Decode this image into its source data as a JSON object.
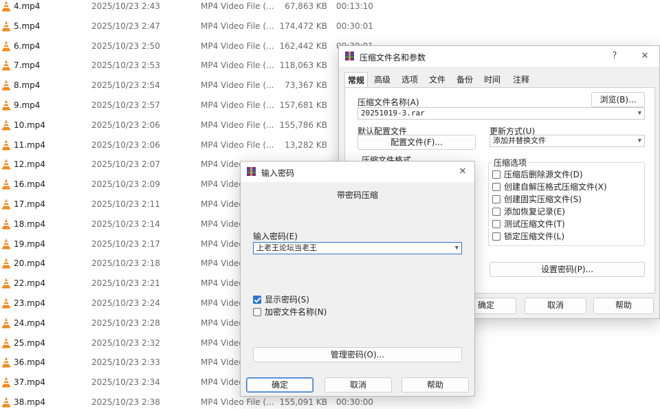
{
  "files": [
    {
      "name": "4.mp4",
      "date": "2025/10/23 2:43",
      "type": "MP4 Video File (...",
      "size": "67,863 KB",
      "duration": "00:13:10"
    },
    {
      "name": "5.mp4",
      "date": "2025/10/23 2:47",
      "type": "MP4 Video File (...",
      "size": "174,472 KB",
      "duration": "00:30:01"
    },
    {
      "name": "6.mp4",
      "date": "2025/10/23 2:50",
      "type": "MP4 Video File (...",
      "size": "162,442 KB",
      "duration": "00:30:01"
    },
    {
      "name": "7.mp4",
      "date": "2025/10/23 2:53",
      "type": "MP4 Video File (...",
      "size": "118,063 KB",
      "duration": ""
    },
    {
      "name": "8.mp4",
      "date": "2025/10/23 2:54",
      "type": "MP4 Video File (...",
      "size": "73,367 KB",
      "duration": ""
    },
    {
      "name": "9.mp4",
      "date": "2025/10/23 2:57",
      "type": "MP4 Video File (...",
      "size": "157,681 KB",
      "duration": ""
    },
    {
      "name": "10.mp4",
      "date": "2025/10/23 2:06",
      "type": "MP4 Video File (...",
      "size": "155,786 KB",
      "duration": ""
    },
    {
      "name": "11.mp4",
      "date": "2025/10/23 2:06",
      "type": "MP4 Video File (...",
      "size": "13,282 KB",
      "duration": ""
    },
    {
      "name": "12.mp4",
      "date": "2025/10/23 2:07",
      "type": "MP4 Video",
      "size": "",
      "duration": ""
    },
    {
      "name": "16.mp4",
      "date": "2025/10/23 2:09",
      "type": "MP4 Video",
      "size": "",
      "duration": ""
    },
    {
      "name": "17.mp4",
      "date": "2025/10/23 2:11",
      "type": "MP4 Video",
      "size": "",
      "duration": ""
    },
    {
      "name": "18.mp4",
      "date": "2025/10/23 2:14",
      "type": "MP4 Video",
      "size": "",
      "duration": ""
    },
    {
      "name": "19.mp4",
      "date": "2025/10/23 2:17",
      "type": "MP4 Video",
      "size": "",
      "duration": ""
    },
    {
      "name": "20.mp4",
      "date": "2025/10/23 2:18",
      "type": "MP4 Video",
      "size": "",
      "duration": ""
    },
    {
      "name": "22.mp4",
      "date": "2025/10/23 2:21",
      "type": "MP4 Video",
      "size": "",
      "duration": ""
    },
    {
      "name": "23.mp4",
      "date": "2025/10/23 2:24",
      "type": "MP4 Video",
      "size": "",
      "duration": ""
    },
    {
      "name": "24.mp4",
      "date": "2025/10/23 2:28",
      "type": "MP4 Video",
      "size": "",
      "duration": ""
    },
    {
      "name": "25.mp4",
      "date": "2025/10/23 2:32",
      "type": "MP4 Video",
      "size": "",
      "duration": ""
    },
    {
      "name": "36.mp4",
      "date": "2025/10/23 2:33",
      "type": "MP4 Video",
      "size": "",
      "duration": ""
    },
    {
      "name": "37.mp4",
      "date": "2025/10/23 2:34",
      "type": "MP4 Video",
      "size": "",
      "duration": ""
    },
    {
      "name": "38.mp4",
      "date": "2025/10/23 2:38",
      "type": "MP4 Video File (...",
      "size": "155,091 KB",
      "duration": "00:30:00"
    }
  ],
  "archive": {
    "title": "压缩文件名和参数",
    "help_glyph": "?",
    "close_glyph": "✕",
    "tabs": [
      "常规",
      "高级",
      "选项",
      "文件",
      "备份",
      "时间",
      "注释"
    ],
    "archive_name_label": "压缩文件名称(A)",
    "browse_button": "浏览(B)...",
    "archive_name_value": "20251019-3.rar",
    "default_profile_label": "默认配置文件",
    "profile_button": "配置文件(F)...",
    "update_mode_label": "更新方式(U)",
    "update_mode_value": "添加并替换文件",
    "hidden_group_label": "压缩文件格式",
    "options_group_label": "压缩选项",
    "options": [
      {
        "label": "压缩后删除源文件(D)",
        "checked": false
      },
      {
        "label": "创建自解压格式压缩文件(X)",
        "checked": false
      },
      {
        "label": "创建固实压缩文件(S)",
        "checked": false
      },
      {
        "label": "添加恢复记录(E)",
        "checked": false
      },
      {
        "label": "测试压缩文件(T)",
        "checked": false
      },
      {
        "label": "锁定压缩文件(L)",
        "checked": false
      }
    ],
    "set_password_button": "设置密码(P)...",
    "ok_button": "确定",
    "cancel_button": "取消",
    "help_button": "帮助"
  },
  "password": {
    "title": "输入密码",
    "close_glyph": "✕",
    "heading": "带密码压缩",
    "enter_label": "输入密码(E)",
    "password_value": "上老王论坛当老王",
    "show_password_label": "显示密码(S)",
    "show_password_checked": true,
    "encrypt_names_label": "加密文件名称(N)",
    "encrypt_names_checked": false,
    "manage_button": "管理密码(O)...",
    "ok_button": "确定",
    "cancel_button": "取消",
    "help_button": "帮助"
  },
  "colors": {
    "vlc_orange": "#f08a1c",
    "accent": "#2f73d8"
  }
}
